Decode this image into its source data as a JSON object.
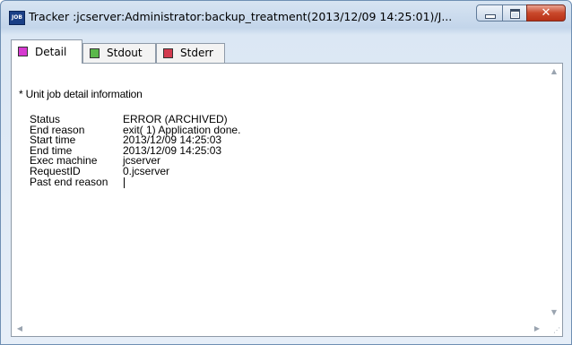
{
  "window": {
    "title": "Tracker :jcserver:Administrator:backup_treatment(2013/12/09 14:25:01)/J...",
    "icon_text": "JOB",
    "close_glyph": "✕"
  },
  "tabs": [
    {
      "label": "Detail",
      "icon_color": "#d63ad0",
      "active": true
    },
    {
      "label": "Stdout",
      "icon_color": "#5bb84b",
      "active": false
    },
    {
      "label": "Stderr",
      "icon_color": "#d33b4f",
      "active": false
    }
  ],
  "detail": {
    "heading": "* Unit job detail information",
    "fields": [
      {
        "label": "Status",
        "value": "ERROR (ARCHIVED)"
      },
      {
        "label": "End reason",
        "value": "exit( 1) Application done."
      },
      {
        "label": "Start time",
        "value": "2013/12/09 14:25:03"
      },
      {
        "label": "End time",
        "value": "2013/12/09 14:25:03"
      },
      {
        "label": "Exec machine",
        "value": "jcserver"
      },
      {
        "label": "RequestID",
        "value": "0.jcserver"
      },
      {
        "label": "Past end reason",
        "value": ""
      }
    ]
  },
  "scrollbar": {
    "up": "▲",
    "down": "▼",
    "left": "◀",
    "right": "▶",
    "grip": "⋰"
  }
}
